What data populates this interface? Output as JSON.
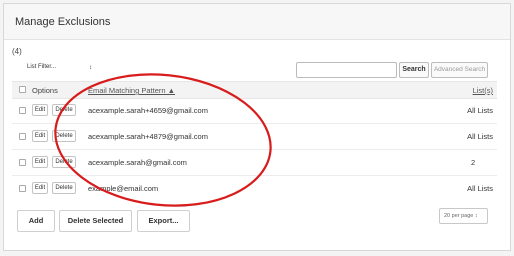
{
  "panel": {
    "title": "Manage Exclusions"
  },
  "count": "(4)",
  "filter": {
    "label": "List Filter...",
    "caret": "↕"
  },
  "search": {
    "placeholder": "",
    "button_label": "Search",
    "advanced_label": "Advanced Search"
  },
  "table": {
    "headers": {
      "options": "Options",
      "pattern": "Email Matching Pattern ▲",
      "lists": "List(s)"
    },
    "rows": [
      {
        "edit": "Edit",
        "delete": "Delete",
        "email": "acexample.sarah+4659@gmail.com",
        "lists": "All Lists"
      },
      {
        "edit": "Edit",
        "delete": "Delete",
        "email": "acexample.sarah+4879@gmail.com",
        "lists": "All Lists"
      },
      {
        "edit": "Edit",
        "delete": "Delete",
        "email": "acexample.sarah@gmail.com",
        "lists": "2"
      },
      {
        "edit": "Edit",
        "delete": "Delete",
        "email": "example@email.com",
        "lists": "All Lists"
      }
    ]
  },
  "actions": {
    "add": "Add",
    "delete_selected": "Delete Selected",
    "export": "Export..."
  },
  "per_page": "20 per page ↕",
  "annotation": {
    "color": "#d81b1b"
  }
}
